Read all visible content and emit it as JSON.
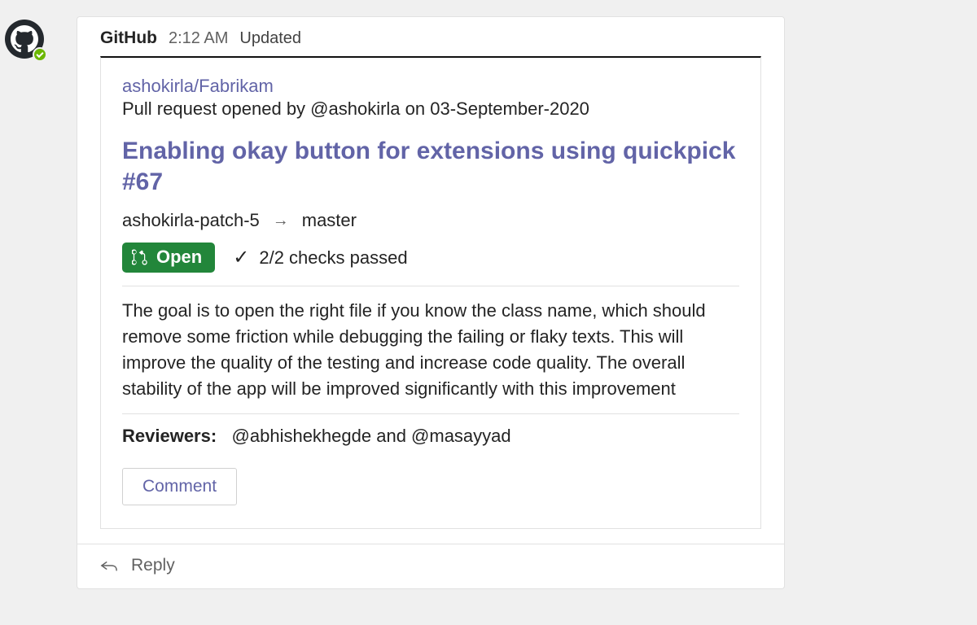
{
  "sender": {
    "name": "GitHub"
  },
  "timestamp": "2:12 AM",
  "edit_status": "Updated",
  "card": {
    "repo": "ashokirla/Fabrikam",
    "opened_by": "Pull request opened by @ashokirla on 03-September-2020",
    "pr_title": "Enabling okay button for extensions using quickpick #67",
    "source_branch": "ashokirla-patch-5",
    "target_branch": "master",
    "status_label": "Open",
    "checks_text": "2/2 checks passed",
    "description": "The goal is to open the right file if you know the class name, which should remove some friction while debugging the failing or flaky texts. This will improve the quality of the testing and increase code quality. The overall stability of the app will be improved significantly with this improvement",
    "reviewers_label": "Reviewers:",
    "reviewers_text": "@abhishekhegde and @masayyad",
    "comment_button": "Comment"
  },
  "reply_placeholder": "Reply",
  "colors": {
    "accent": "#6264a7",
    "open_badge": "#22863a"
  }
}
